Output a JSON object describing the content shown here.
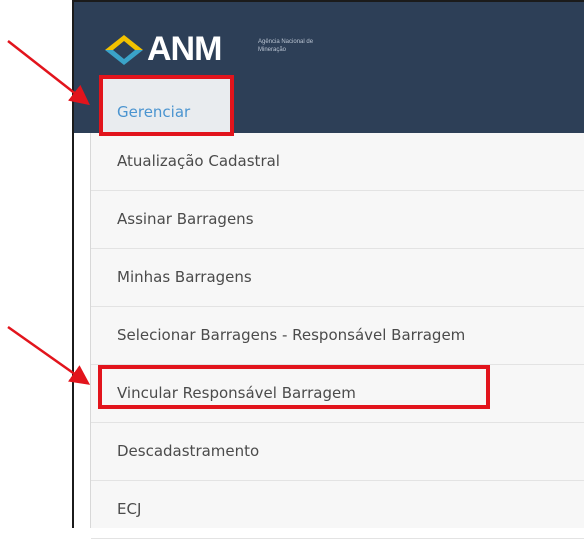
{
  "header": {
    "logo_text": "ANM",
    "logo_subtext": "Agência Nacional de Mineração",
    "menu_trigger_label": "Gerenciar",
    "background_color": "#2d3f57"
  },
  "menu": {
    "items": [
      {
        "label": "Atualização Cadastral"
      },
      {
        "label": "Assinar Barragens"
      },
      {
        "label": "Minhas Barragens"
      },
      {
        "label": "Selecionar Barragens - Responsável Barragem"
      },
      {
        "label": "Vincular Responsável Barragem"
      },
      {
        "label": "Descadastramento"
      },
      {
        "label": "ECJ"
      }
    ]
  },
  "annotations": {
    "highlight_color": "#e2141c",
    "highlighted_items": [
      "Gerenciar",
      "Vincular Responsável Barragem"
    ]
  }
}
